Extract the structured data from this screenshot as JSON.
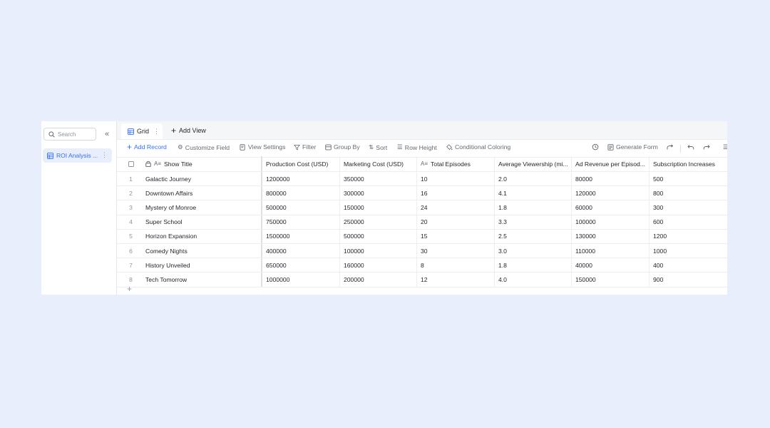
{
  "sidebar": {
    "search_placeholder": "Search",
    "table_name": "ROI Analysis ..."
  },
  "tabs": {
    "grid_label": "Grid",
    "add_view_label": "Add View"
  },
  "toolbar": {
    "add_record": "Add Record",
    "customize_field": "Customize Field",
    "view_settings": "View Settings",
    "filter": "Filter",
    "group_by": "Group By",
    "sort": "Sort",
    "row_height": "Row Height",
    "conditional_coloring": "Conditional Coloring",
    "generate_form": "Generate Form"
  },
  "columns": {
    "title": "Show Title",
    "production": "Production Cost (USD)",
    "marketing": "Marketing Cost (USD)",
    "episodes": "Total Episodes",
    "viewership": "Average Viewership (mi...",
    "ad_revenue": "Ad Revenue per Episod...",
    "subscriptions": "Subscription Increases"
  },
  "rows": [
    {
      "n": "1",
      "title": "Galactic Journey",
      "production": "1200000",
      "marketing": "350000",
      "episodes": "10",
      "viewership": "2.0",
      "ad_revenue": "80000",
      "subscriptions": "500"
    },
    {
      "n": "2",
      "title": "Downtown Affairs",
      "production": "800000",
      "marketing": "300000",
      "episodes": "16",
      "viewership": "4.1",
      "ad_revenue": "120000",
      "subscriptions": "800"
    },
    {
      "n": "3",
      "title": "Mystery of Monroe",
      "production": "500000",
      "marketing": "150000",
      "episodes": "24",
      "viewership": "1.8",
      "ad_revenue": "60000",
      "subscriptions": "300"
    },
    {
      "n": "4",
      "title": "Super School",
      "production": "750000",
      "marketing": "250000",
      "episodes": "20",
      "viewership": "3.3",
      "ad_revenue": "100000",
      "subscriptions": "600"
    },
    {
      "n": "5",
      "title": "Horizon Expansion",
      "production": "1500000",
      "marketing": "500000",
      "episodes": "15",
      "viewership": "2.5",
      "ad_revenue": "130000",
      "subscriptions": "1200"
    },
    {
      "n": "6",
      "title": "Comedy Nights",
      "production": "400000",
      "marketing": "100000",
      "episodes": "30",
      "viewership": "3.0",
      "ad_revenue": "110000",
      "subscriptions": "1000"
    },
    {
      "n": "7",
      "title": "History Unveiled",
      "production": "650000",
      "marketing": "160000",
      "episodes": "8",
      "viewership": "1.8",
      "ad_revenue": "40000",
      "subscriptions": "400"
    },
    {
      "n": "8",
      "title": "Tech Tomorrow",
      "production": "1000000",
      "marketing": "200000",
      "episodes": "12",
      "viewership": "4.0",
      "ad_revenue": "150000",
      "subscriptions": "900"
    }
  ],
  "add_row_symbol": "+",
  "colors": {
    "accent": "#3370ff",
    "background": "#e9eefc"
  }
}
